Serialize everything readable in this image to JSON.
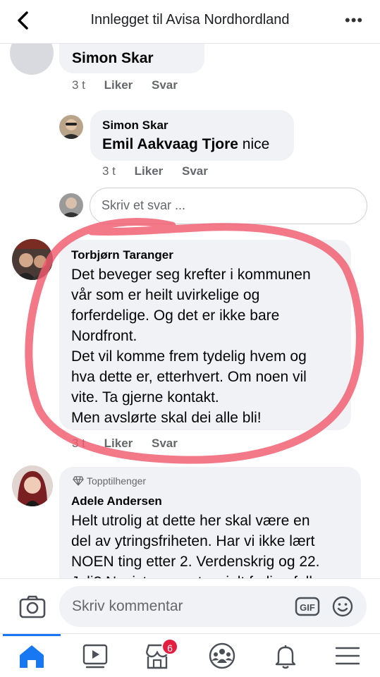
{
  "header": {
    "title": "Innlegget til Avisa Nordhordland",
    "more_label": "•••"
  },
  "comments": [
    {
      "name": "Simon Skar",
      "time": "3 t",
      "like": "Liker",
      "reply": "Svar"
    },
    {
      "author": "Simon Skar",
      "mention": "Emil Aakvaag Tjore",
      "text": " nice",
      "time": "3 t",
      "like": "Liker",
      "reply": "Svar"
    },
    {
      "author": "Torbjørn Taranger",
      "lines": [
        "Det beveger seg krefter i kommunen",
        "vår som er heilt uvirkelige og",
        "forferdelige. Og det er ikke bare",
        "Nordfront.",
        "Det vil komme frem tydelig hvem og",
        "hva dette er, etterhvert. Om noen vil",
        "vite. Ta gjerne kontakt.",
        "Men avslørte skal dei alle bli!"
      ],
      "time": "3 t",
      "like": "Liker",
      "reply": "Svar"
    },
    {
      "badge": "Topptilhenger",
      "author": "Adele Andersen",
      "lines": [
        "Helt utrolig at dette her skal være en",
        "del av ytringsfriheten. Har vi ikke lært",
        "NOEN ting etter 2. Verdenskrig og 22.",
        "Juli? Nazister er potensielt farlige folk"
      ]
    }
  ],
  "reply_input": {
    "placeholder": "Skriv et svar ..."
  },
  "composer": {
    "placeholder": "Skriv kommentar",
    "gif_label": "GIF"
  },
  "tabbar": {
    "items": [
      "home-icon",
      "video-icon",
      "marketplace-icon",
      "groups-icon",
      "bell-icon",
      "menu-icon"
    ],
    "marketplace_badge": "6",
    "active_color": "#1877f2"
  },
  "colors": {
    "accent": "#1877f2",
    "bubble": "#f0f2f5",
    "annotation": "#f05a6e"
  }
}
